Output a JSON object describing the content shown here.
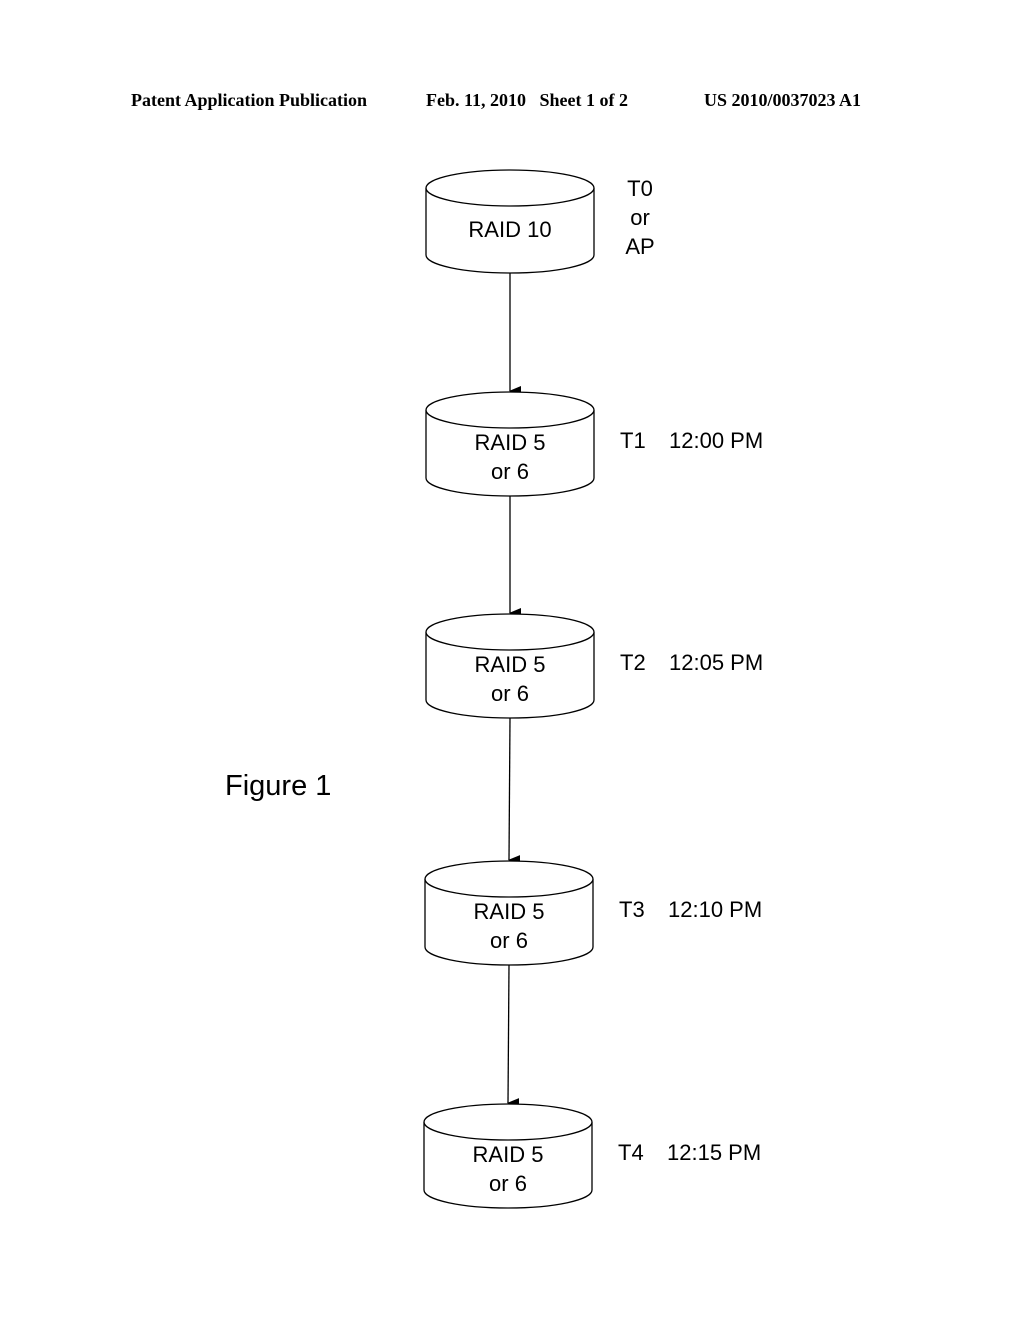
{
  "header": {
    "publication": "Patent Application Publication",
    "date_sheet": "Feb. 11, 2010   Sheet 1 of 2",
    "number": "US 2010/0037023 A1"
  },
  "figure_label": "Figure 1",
  "nodes": [
    {
      "lines": [
        "RAID 10"
      ],
      "time_label": [
        "T0",
        "or",
        "AP"
      ],
      "time": ""
    },
    {
      "lines": [
        "RAID 5",
        "or 6"
      ],
      "time_label": [
        "T1"
      ],
      "time": "12:00 PM"
    },
    {
      "lines": [
        "RAID 5",
        "or 6"
      ],
      "time_label": [
        "T2"
      ],
      "time": "12:05 PM"
    },
    {
      "lines": [
        "RAID 5",
        "or 6"
      ],
      "time_label": [
        "T3"
      ],
      "time": "12:10 PM"
    },
    {
      "lines": [
        "RAID 5",
        "or 6"
      ],
      "time_label": [
        "T4"
      ],
      "time": "12:15 PM"
    }
  ],
  "edges": [
    [
      0,
      1
    ],
    [
      1,
      2
    ],
    [
      2,
      3
    ],
    [
      3,
      4
    ]
  ]
}
